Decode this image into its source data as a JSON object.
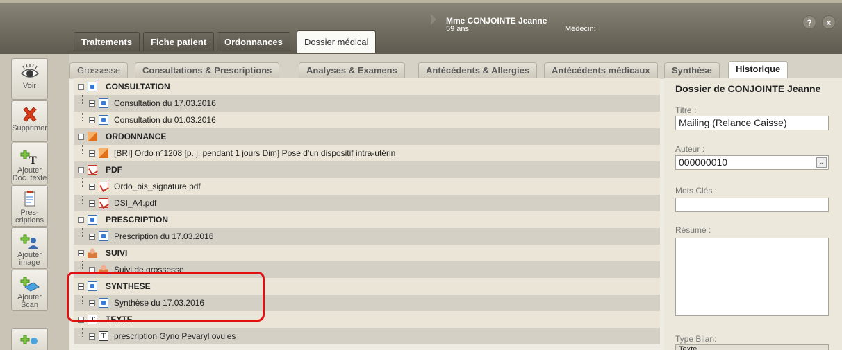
{
  "header": {
    "main_tabs": [
      "Traitements",
      "Fiche patient",
      "Ordonnances",
      "Dossier médical"
    ],
    "active_tab": "Dossier médical",
    "patient_name": "Mme CONJOINTE Jeanne",
    "patient_age": "59 ans",
    "doctor_label": "Médecin:",
    "help_button": "?",
    "close_button": "×"
  },
  "toolbar": {
    "items": [
      {
        "label": "Voir",
        "icon": "eye-icon"
      },
      {
        "label": "Supprimer",
        "icon": "delete-x-icon"
      },
      {
        "label": "Ajouter Doc. texte",
        "icon": "add-text-doc-icon"
      },
      {
        "label": "Pres-criptions",
        "icon": "prescription-icon"
      },
      {
        "label": "Ajouter image",
        "icon": "add-image-icon"
      },
      {
        "label": "Ajouter Scan",
        "icon": "add-scan-icon"
      }
    ]
  },
  "subtabs": [
    "Grossesse",
    "Consultations & Prescriptions",
    "Analyses & Examens",
    "Antécédents & Allergies",
    "Antécédents médicaux"
  ],
  "right_tabs": [
    "Synthèse",
    "Historique"
  ],
  "active_right_tab": "Historique",
  "tree": {
    "rows": [
      {
        "text": "CONSULTATION",
        "type": "category",
        "icon": "doc-icon"
      },
      {
        "text": "Consultation du 17.03.2016",
        "type": "item",
        "icon": "doc-icon"
      },
      {
        "text": "Consultation du 01.03.2016",
        "type": "item",
        "icon": "doc-icon"
      },
      {
        "text": "ORDONNANCE",
        "type": "category",
        "icon": "ordonnance-icon"
      },
      {
        "text": "[BRI] Ordo n°1208 [p. j. pendant 1 jours Dim] Pose d'un dispositif intra-utérin",
        "type": "item",
        "icon": "ordonnance-icon"
      },
      {
        "text": "PDF",
        "type": "category",
        "icon": "pdf-icon"
      },
      {
        "text": "Ordo_bis_signature.pdf",
        "type": "item",
        "icon": "pdf-icon"
      },
      {
        "text": "DSI_A4.pdf",
        "type": "item",
        "icon": "pdf-icon"
      },
      {
        "text": "PRESCRIPTION",
        "type": "category",
        "icon": "doc-icon"
      },
      {
        "text": "Prescription du 17.03.2016",
        "type": "item",
        "icon": "doc-icon"
      },
      {
        "text": "SUIVI",
        "type": "category",
        "icon": "suivi-icon"
      },
      {
        "text": "Suivi de grossesse",
        "type": "item",
        "icon": "suivi-icon"
      },
      {
        "text": "SYNTHESE",
        "type": "category",
        "icon": "doc-icon"
      },
      {
        "text": "Synthèse du 17.03.2016",
        "type": "item",
        "icon": "doc-icon"
      },
      {
        "text": "TEXTE",
        "type": "category",
        "icon": "texte-icon"
      },
      {
        "text": "prescription Gyno Pevaryl ovules",
        "type": "item",
        "icon": "texte-icon"
      }
    ]
  },
  "form": {
    "title": "Dossier de CONJOINTE Jeanne",
    "titre_label": "Titre :",
    "titre_value": "Mailing (Relance Caisse)",
    "auteur_label": "Auteur :",
    "auteur_value": "000000010",
    "mots_cles_label": "Mots Clés :",
    "mots_cles_value": "",
    "resume_label": "Résumé :",
    "resume_value": "",
    "type_bilan_label": "Type Bilan:",
    "type_bilan_value": "Texte"
  },
  "colors": {
    "highlight": "#e01010",
    "header": "#6f6b5f"
  }
}
